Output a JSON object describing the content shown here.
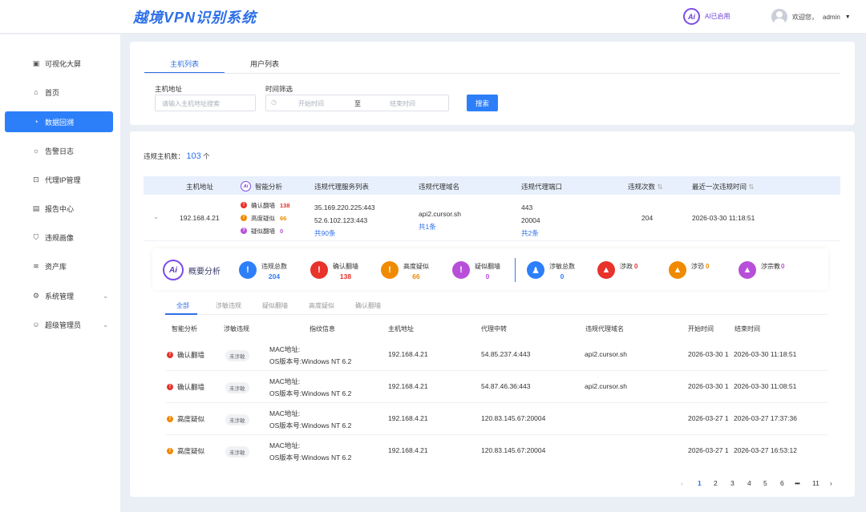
{
  "header": {
    "title": "越境VPN识别系统",
    "ai_status": "AI已启用",
    "ai_logo": "Ai",
    "welcome": "欢迎您，",
    "username": "admin"
  },
  "sidebar": {
    "items": [
      {
        "label": "可视化大屏",
        "icon": "monitor-icon"
      },
      {
        "label": "首页",
        "icon": "home-icon"
      },
      {
        "label": "数据回溯",
        "icon": "pie-chart-icon",
        "active": true
      },
      {
        "label": "告警日志",
        "icon": "bulb-icon"
      },
      {
        "label": "代理IP管理",
        "icon": "proxy-icon"
      },
      {
        "label": "报告中心",
        "icon": "report-icon"
      },
      {
        "label": "违规画像",
        "icon": "shield-icon"
      },
      {
        "label": "资产库",
        "icon": "layers-icon"
      },
      {
        "label": "系统管理",
        "icon": "settings-icon"
      },
      {
        "label": "超级管理员",
        "icon": "admin-icon"
      }
    ]
  },
  "tabs": [
    "主机列表",
    "用户列表"
  ],
  "filters": {
    "host_label": "主机地址",
    "host_placeholder": "请输入主机地址搜索",
    "time_label": "时间筛选",
    "start_placeholder": "开始时间",
    "to": "至",
    "end_placeholder": "结束时间",
    "search_button": "搜索"
  },
  "summary_count": {
    "label": "违规主机数：",
    "value": "103",
    "unit": "个"
  },
  "table": {
    "headers": [
      "主机地址",
      "智能分析",
      "违规代理服务列表",
      "违规代理域名",
      "违规代理端口",
      "违规次数",
      "最近一次违规时间"
    ],
    "row": {
      "host": "192.168.4.21",
      "analysis": [
        {
          "label": "确认翻墙",
          "value": "138",
          "color": "#e8322b"
        },
        {
          "label": "高度疑似",
          "value": "66",
          "color": "#f08a00"
        },
        {
          "label": "疑似翻墙",
          "value": "0",
          "color": "#b84fd8"
        }
      ],
      "services": [
        "35.169.220.225:443",
        "52.6.102.123:443"
      ],
      "services_more": "共90条",
      "domain": "api2.cursor.sh",
      "domain_more": "共1条",
      "ports": [
        "443",
        "20004"
      ],
      "ports_more": "共2条",
      "count": "204",
      "last_time": "2026-03-30 11:18:51"
    }
  },
  "overview": {
    "title": "概要分析",
    "stats": [
      {
        "label": "违规总数",
        "value": "204",
        "color": "#2d7ff9",
        "icon": "shield-exclaim-icon"
      },
      {
        "label": "确认翻墙",
        "value": "138",
        "color": "#e8322b",
        "icon": "exclaim-icon"
      },
      {
        "label": "高度疑似",
        "value": "66",
        "color": "#f08a00",
        "icon": "exclaim-icon"
      },
      {
        "label": "疑似翻墙",
        "value": "0",
        "color": "#b84fd8",
        "icon": "exclaim-icon"
      },
      {
        "label": "涉敏总数",
        "value": "0",
        "color": "#2d7ff9",
        "icon": "shield-person-icon"
      },
      {
        "label": "涉政",
        "value": "0",
        "color": "#e8322b",
        "icon": "warning-icon"
      },
      {
        "label": "涉恐",
        "value": "0",
        "color": "#f08a00",
        "icon": "warning-icon"
      },
      {
        "label": "涉宗教",
        "value": "0",
        "color": "#b84fd8",
        "icon": "warning-icon"
      }
    ]
  },
  "detail": {
    "subtabs": [
      "全部",
      "涉敏违规",
      "疑似翻墙",
      "高度疑似",
      "确认翻墙"
    ],
    "headers": [
      "智能分析",
      "涉敏违规",
      "指纹信息",
      "主机地址",
      "代理中转",
      "违规代理域名",
      "开始时间",
      "结束时间"
    ],
    "rows": [
      {
        "level": "确认翻墙",
        "color": "#e8322b",
        "tag": "未涉敏",
        "fp1": "MAC地址:",
        "fp2": "OS版本号:Windows NT 6.2",
        "host": "192.168.4.21",
        "proxy": "54.85.237.4:443",
        "domain": "api2.cursor.sh",
        "start": "2026-03-30 1",
        "end": "2026-03-30 11:18:51"
      },
      {
        "level": "确认翻墙",
        "color": "#e8322b",
        "tag": "未涉敏",
        "fp1": "MAC地址:",
        "fp2": "OS版本号:Windows NT 6.2",
        "host": "192.168.4.21",
        "proxy": "54.87.46.36:443",
        "domain": "api2.cursor.sh",
        "start": "2026-03-30 1",
        "end": "2026-03-30 11:08:51"
      },
      {
        "level": "高度疑似",
        "color": "#f08a00",
        "tag": "未涉敏",
        "fp1": "MAC地址:",
        "fp2": "OS版本号:Windows NT 6.2",
        "host": "192.168.4.21",
        "proxy": "120.83.145.67:20004",
        "domain": "",
        "start": "2026-03-27 1",
        "end": "2026-03-27 17:37:36"
      },
      {
        "level": "高度疑似",
        "color": "#f08a00",
        "tag": "未涉敏",
        "fp1": "MAC地址:",
        "fp2": "OS版本号:Windows NT 6.2",
        "host": "192.168.4.21",
        "proxy": "120.83.145.67:20004",
        "domain": "",
        "start": "2026-03-27 1",
        "end": "2026-03-27 16:53:12"
      }
    ]
  },
  "pagination": {
    "pages": [
      "1",
      "2",
      "3",
      "4",
      "5",
      "6",
      "•••",
      "11"
    ],
    "current": "1",
    "prev": "‹",
    "next": "›"
  }
}
